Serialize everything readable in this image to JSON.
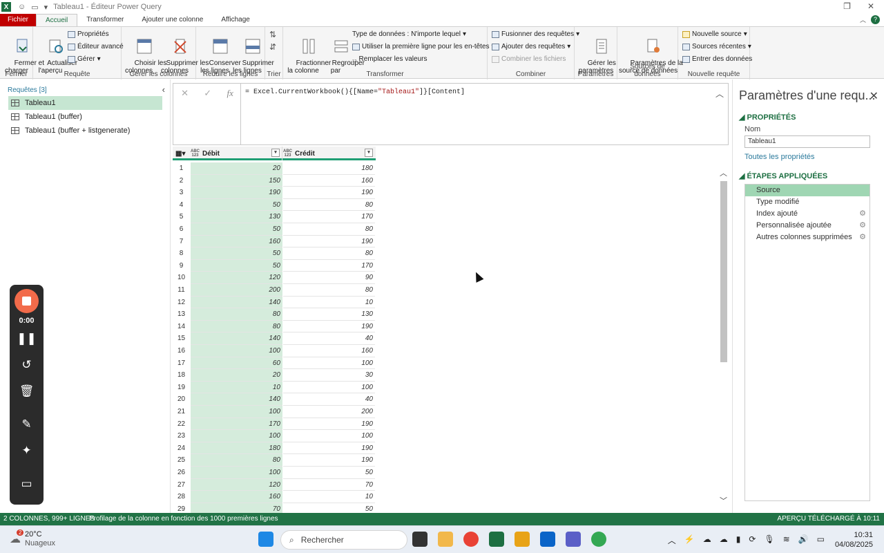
{
  "window": {
    "title": "Tableau1 - Éditeur Power Query"
  },
  "tabs": [
    {
      "label": "Fichier"
    },
    {
      "label": "Accueil"
    },
    {
      "label": "Transformer"
    },
    {
      "label": "Ajouter une colonne"
    },
    {
      "label": "Affichage"
    }
  ],
  "ribbon": {
    "fermer": {
      "btn": "Fermer et\ncharger",
      "group": "Fermer"
    },
    "requete": {
      "actualiser": "Actualiser\nl'aperçu",
      "proprietes": "Propriétés",
      "editeur": "Éditeur avancé",
      "gerer": "Gérer",
      "group": "Requête"
    },
    "colonnes": {
      "choisir": "Choisir les\ncolonnes",
      "supprimer": "Supprimer les\ncolonnes",
      "group": "Gérer les colonnes"
    },
    "lignes": {
      "conserver": "Conserver\nles lignes",
      "supprimer": "Supprimer\nles lignes",
      "group": "Réduire les lignes"
    },
    "trier": {
      "group": "Trier"
    },
    "transformer": {
      "fractionner": "Fractionner\nla colonne",
      "regrouper": "Regrouper\npar",
      "type": "Type de données : N'importe lequel",
      "premiere": "Utiliser la première ligne pour les en-têtes",
      "remplacer": "Remplacer les valeurs",
      "group": "Transformer"
    },
    "combiner": {
      "fusionner": "Fusionner des requêtes",
      "ajouter": "Ajouter des requêtes",
      "combiner": "Combiner les fichiers",
      "group": "Combiner"
    },
    "parametres": {
      "gerer": "Gérer les\nparamètres",
      "group": "Paramètres"
    },
    "sources": {
      "params": "Paramètres de la\nsource de données",
      "group": "Sources de données"
    },
    "nouvelle": {
      "source": "Nouvelle source",
      "recentes": "Sources récentes",
      "entrer": "Entrer des données",
      "group": "Nouvelle requête"
    }
  },
  "queries": {
    "header": "Requêtes [3]",
    "items": [
      {
        "label": "Tableau1"
      },
      {
        "label": "Tableau1 (buffer)"
      },
      {
        "label": "Tableau1 (buffer + listgenerate)"
      }
    ]
  },
  "formula": {
    "prefix": "= Excel.CurrentWorkbook(){[Name=",
    "string": "\"Tableau1\"",
    "suffix": "]}[Content]"
  },
  "grid": {
    "type_top": "ABC",
    "type_bottom": "123",
    "columns": [
      "Débit",
      "Crédit"
    ],
    "rows": [
      [
        1,
        20,
        180
      ],
      [
        2,
        150,
        160
      ],
      [
        3,
        190,
        190
      ],
      [
        4,
        50,
        80
      ],
      [
        5,
        130,
        170
      ],
      [
        6,
        50,
        80
      ],
      [
        7,
        160,
        190
      ],
      [
        8,
        50,
        80
      ],
      [
        9,
        50,
        170
      ],
      [
        10,
        120,
        90
      ],
      [
        11,
        200,
        80
      ],
      [
        12,
        140,
        10
      ],
      [
        13,
        80,
        130
      ],
      [
        14,
        80,
        190
      ],
      [
        15,
        140,
        40
      ],
      [
        16,
        100,
        160
      ],
      [
        17,
        60,
        100
      ],
      [
        18,
        20,
        30
      ],
      [
        19,
        10,
        100
      ],
      [
        20,
        140,
        40
      ],
      [
        21,
        100,
        200
      ],
      [
        22,
        170,
        190
      ],
      [
        23,
        100,
        100
      ],
      [
        24,
        180,
        190
      ],
      [
        25,
        80,
        190
      ],
      [
        26,
        100,
        50
      ],
      [
        27,
        120,
        70
      ],
      [
        28,
        160,
        10
      ],
      [
        29,
        70,
        50
      ]
    ]
  },
  "recorder": {
    "time": "0:00"
  },
  "settings": {
    "title": "Paramètres d'une requ...",
    "properties_header": "PROPRIÉTÉS",
    "name_label": "Nom",
    "name_value": "Tableau1",
    "all_props": "Toutes les propriétés",
    "steps_header": "ÉTAPES APPLIQUÉES",
    "steps": [
      {
        "label": "Source",
        "gear": false
      },
      {
        "label": "Type modifié",
        "gear": false
      },
      {
        "label": "Index ajouté",
        "gear": true
      },
      {
        "label": "Personnalisée ajoutée",
        "gear": true
      },
      {
        "label": "Autres colonnes supprimées",
        "gear": true
      }
    ]
  },
  "status": {
    "left": "2 COLONNES, 999+ LIGNES",
    "middle": "Profilage de la colonne en fonction des 1000 premières lignes",
    "right": "APERÇU TÉLÉCHARGÉ À 10:11"
  },
  "taskbar": {
    "temp": "20°C",
    "weather": "Nuageux",
    "badge": "2",
    "search": "Rechercher",
    "time": "10:31",
    "date": "04/08/2025"
  },
  "colors": {
    "accent": "#217346",
    "file_tab": "#c00000",
    "selection": "#c6e6d2"
  }
}
